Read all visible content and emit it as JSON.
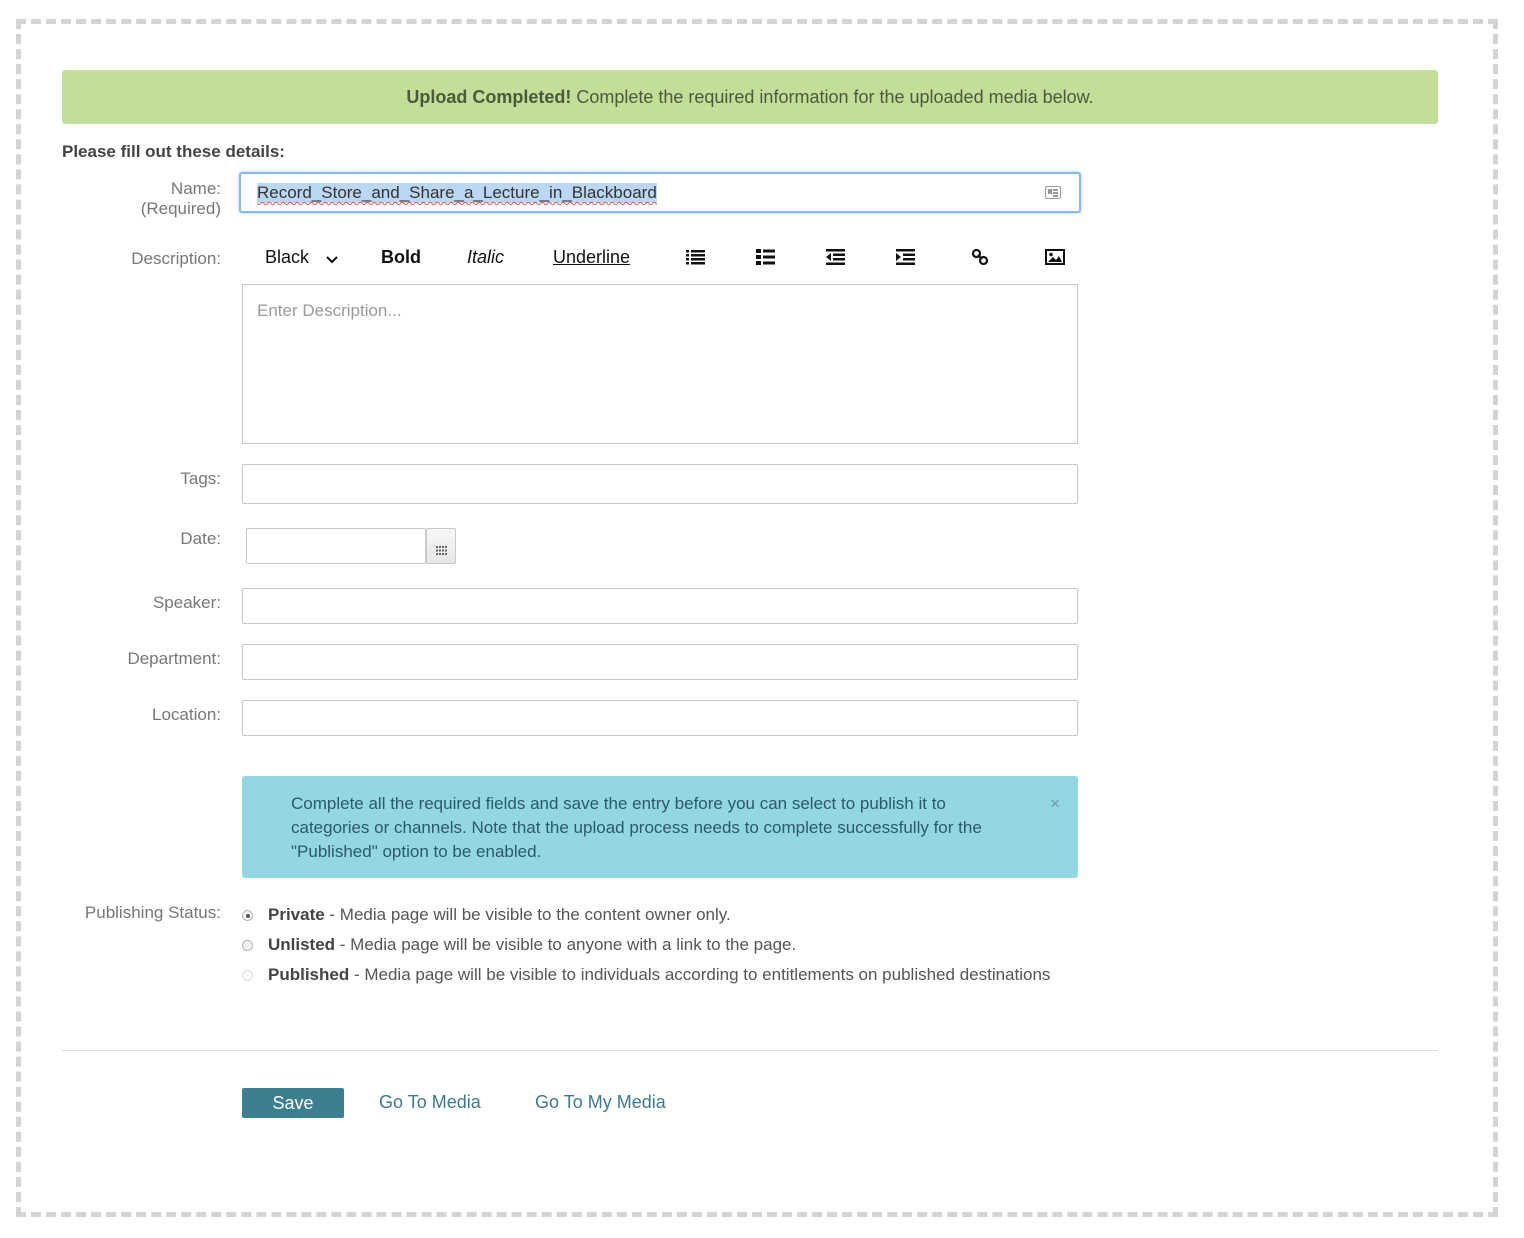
{
  "banner": {
    "strong": "Upload Completed!",
    "text": "Complete the required information for the uploaded media below."
  },
  "form": {
    "intro": "Please fill out these details:",
    "name_label": "Name:",
    "name_required": "(Required)",
    "name_value": "Record_Store_and_Share_a_Lecture_in_Blackboard",
    "description_label": "Description:",
    "description_placeholder": "Enter Description...",
    "tags_label": "Tags:",
    "date_label": "Date:",
    "speaker_label": "Speaker:",
    "department_label": "Department:",
    "location_label": "Location:"
  },
  "toolbar": {
    "color": "Black",
    "bold": "Bold",
    "italic": "Italic",
    "underline": "Underline",
    "icons": [
      "unordered-list-icon",
      "ordered-list-icon",
      "outdent-icon",
      "indent-icon",
      "link-icon",
      "image-icon"
    ]
  },
  "info": {
    "text": "Complete all the required fields and save the entry before you can select to publish it to categories or channels. Note that the upload process needs to complete successfully for the \"Published\" option to be enabled.",
    "close": "×"
  },
  "publishing": {
    "label": "Publishing Status:",
    "options": [
      {
        "name": "Private",
        "desc": " - Media page will be visible to the content owner only.",
        "checked": true,
        "disabled": false
      },
      {
        "name": "Unlisted",
        "desc": " - Media page will be visible to anyone with a link to the page.",
        "checked": false,
        "disabled": false
      },
      {
        "name": "Published",
        "desc": " - Media page will be visible to individuals according to entitlements on published destinations",
        "checked": false,
        "disabled": true
      }
    ]
  },
  "actions": {
    "save": "Save",
    "go_to_media": "Go To Media",
    "go_to_my_media": "Go To My Media"
  },
  "colors": {
    "banner_bg": "#c2de98",
    "info_bg": "#93d6e4",
    "save_bg": "#3c8090",
    "link": "#3d7a8c"
  }
}
